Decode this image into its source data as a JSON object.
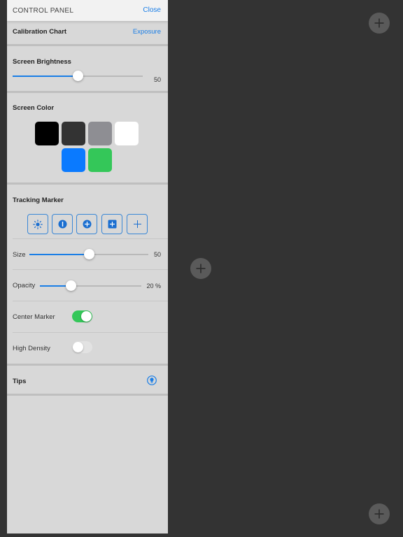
{
  "header": {
    "title": "CONTROL PANEL",
    "close_label": "Close"
  },
  "calibration": {
    "title": "Calibration Chart",
    "exposure_label": "Exposure"
  },
  "brightness": {
    "title": "Screen Brightness",
    "value": "50",
    "level": 0.5
  },
  "screen_color": {
    "title": "Screen Color",
    "swatches": [
      "#000000",
      "#333333",
      "#8e8e93",
      "#ffffff",
      "#0a7aff",
      "#34c759"
    ]
  },
  "tracking": {
    "title": "Tracking Marker",
    "markers": [
      "sun-marker-icon",
      "info-marker-icon",
      "plus-circle-marker-icon",
      "plus-square-marker-icon",
      "plus-marker-icon"
    ],
    "size": {
      "label": "Size",
      "value": "50",
      "level": 0.5
    },
    "opacity": {
      "label": "Opacity",
      "value": "20 %",
      "level": 0.3
    },
    "center_marker": {
      "label": "Center Marker",
      "on": true
    },
    "high_density": {
      "label": "High Density",
      "on": false
    }
  },
  "tips": {
    "title": "Tips",
    "icon": "lightbulb-icon"
  },
  "colors": {
    "accent": "#1a7ee6",
    "toggle_on": "#34c759",
    "toggle_off": "#e2e2e2",
    "panel_bg": "#d8d8d8",
    "canvas_bg": "#333333"
  },
  "canvas": {
    "buttons": [
      "plus-icon",
      "plus-icon",
      "plus-icon"
    ]
  }
}
